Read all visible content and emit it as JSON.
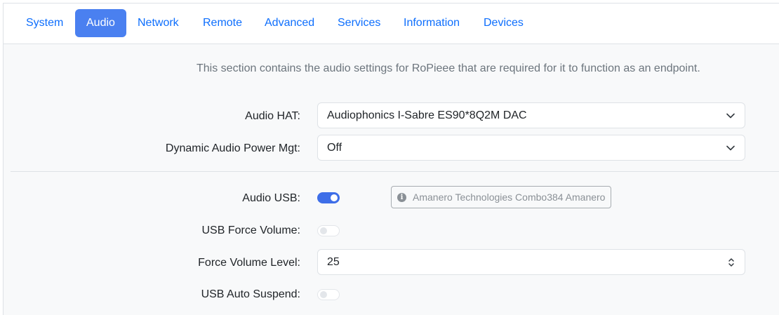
{
  "tabs": [
    {
      "label": "System",
      "active": false
    },
    {
      "label": "Audio",
      "active": true
    },
    {
      "label": "Network",
      "active": false
    },
    {
      "label": "Remote",
      "active": false
    },
    {
      "label": "Advanced",
      "active": false
    },
    {
      "label": "Services",
      "active": false
    },
    {
      "label": "Information",
      "active": false
    },
    {
      "label": "Devices",
      "active": false
    }
  ],
  "intro": "This section contains the audio settings for RoPieee that are required for it to function as an endpoint.",
  "audio_hat": {
    "label": "Audio HAT:",
    "value": "Audiophonics I-Sabre ES90*8Q2M DAC",
    "icon": "chevron-down-icon"
  },
  "dapm": {
    "label": "Dynamic Audio Power Mgt:",
    "value": "Off",
    "icon": "chevron-down-icon"
  },
  "audio_usb": {
    "label": "Audio USB:",
    "enabled": true,
    "device_info": "Amanero Technologies Combo384 Amanero",
    "info_icon": "info-circle-icon"
  },
  "usb_force_volume": {
    "label": "USB Force Volume:",
    "enabled": false
  },
  "force_volume_level": {
    "label": "Force Volume Level:",
    "value": "25",
    "icon": "updown-chevron-icon"
  },
  "usb_auto_suspend": {
    "label": "USB Auto Suspend:",
    "enabled": false
  },
  "colors": {
    "accent": "#3e6ee8",
    "link": "#0d6efd",
    "muted_text": "#6c757d",
    "background": "#f8f9fa"
  }
}
